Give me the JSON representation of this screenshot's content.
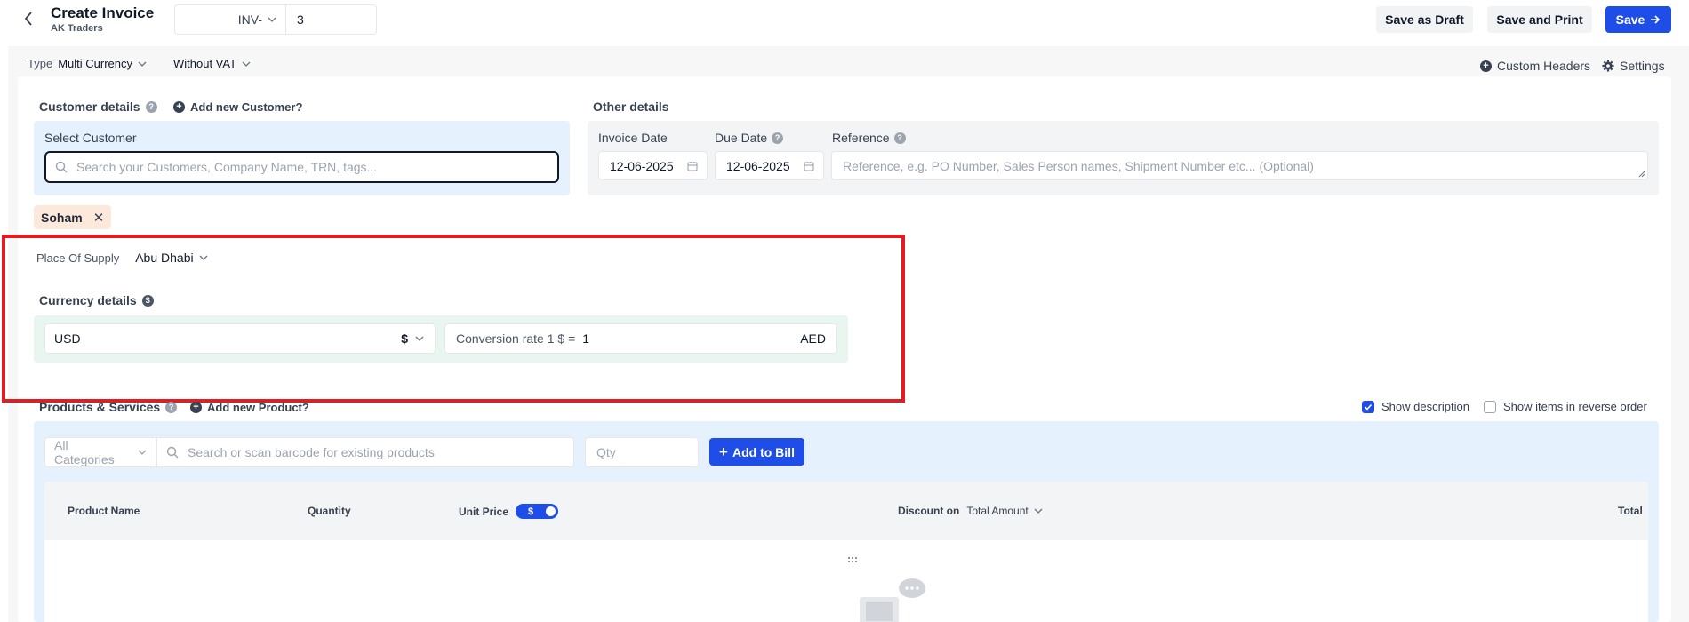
{
  "header": {
    "title": "Create Invoice",
    "subtitle": "AK Traders",
    "invoice_prefix": "INV-",
    "invoice_number": "3",
    "save_draft_label": "Save as Draft",
    "save_print_label": "Save and Print",
    "save_label": "Save"
  },
  "typebar": {
    "type_label": "Type",
    "type_value": "Multi Currency",
    "vat_value": "Without VAT",
    "custom_headers_label": "Custom Headers",
    "settings_label": "Settings"
  },
  "customer": {
    "section_label": "Customer details",
    "add_new_label": "Add new Customer?",
    "select_label": "Select Customer",
    "search_placeholder": "Search your Customers, Company Name, TRN, tags...",
    "selected_chip": "Soham"
  },
  "other": {
    "section_label": "Other details",
    "invoice_date_label": "Invoice Date",
    "invoice_date": "12-06-2025",
    "due_date_label": "Due Date",
    "due_date": "12-06-2025",
    "reference_label": "Reference",
    "reference_placeholder": "Reference, e.g. PO Number, Sales Person names, Shipment Number etc... (Optional)"
  },
  "supply": {
    "label": "Place Of Supply",
    "value": "Abu Dhabi"
  },
  "currency": {
    "section_label": "Currency details",
    "code": "USD",
    "symbol": "$",
    "conversion_label": "Conversion rate 1 $ =",
    "conversion_value": "1",
    "base_currency": "AED"
  },
  "products": {
    "section_label": "Products & Services",
    "add_new_label": "Add new Product?",
    "show_description_label": "Show description",
    "reverse_order_label": "Show items in reverse order",
    "category_placeholder": "All Categories",
    "search_placeholder": "Search or scan barcode for existing products",
    "qty_placeholder": "Qty",
    "add_to_bill_label": "Add to Bill",
    "columns": {
      "product_name": "Product Name",
      "quantity": "Quantity",
      "unit_price": "Unit Price",
      "price_toggle": "$",
      "discount_on": "Discount on",
      "discount_value": "Total Amount",
      "total": "Total"
    }
  },
  "colors": {
    "accent": "#1f4de8",
    "highlight": "#e11d21"
  }
}
